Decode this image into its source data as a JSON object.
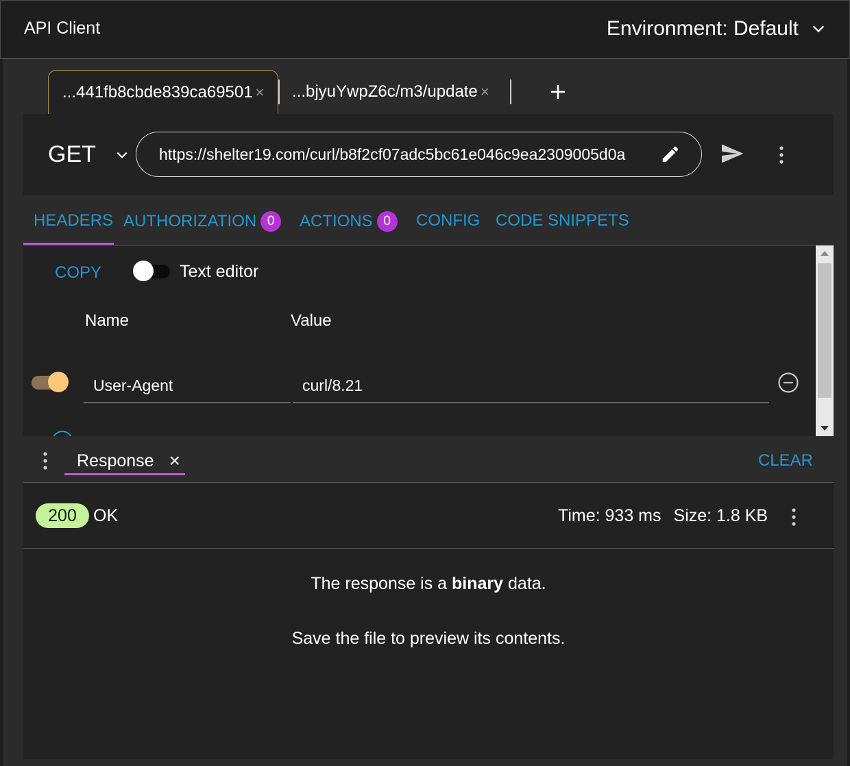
{
  "app": {
    "title": "API Client"
  },
  "environment": {
    "label": "Environment: Default"
  },
  "tabs": [
    {
      "label": "...441fb8cbde839ca69501",
      "active": true
    },
    {
      "label": "...bjyuYwpZ6c/m3/update",
      "active": false
    }
  ],
  "tab_close_glyph": "×",
  "request": {
    "method": "GET",
    "url": "https://shelter19.com/curl/b8f2cf07adc5bc61e046c9ea2309005d0a"
  },
  "request_tabs": [
    {
      "label": "HEADERS",
      "badge": null
    },
    {
      "label": "AUTHORIZATION",
      "badge": "0"
    },
    {
      "label": "ACTIONS",
      "badge": "0"
    },
    {
      "label": "CONFIG",
      "badge": null
    },
    {
      "label": "CODE SNIPPETS",
      "badge": null
    }
  ],
  "headers_panel": {
    "copy_label": "COPY",
    "text_editor_label": "Text editor",
    "text_editor_enabled": false,
    "columns": {
      "name": "Name",
      "value": "Value"
    },
    "rows": [
      {
        "enabled": true,
        "name": "User-Agent",
        "value": "curl/8.21"
      }
    ]
  },
  "response_panel": {
    "tab_label": "Response",
    "close_glyph": "×",
    "clear_label": "CLEAR",
    "status_code": "200",
    "status_text": "OK",
    "time": "Time: 933 ms",
    "size": "Size: 1.8 KB",
    "message_prefix": "The response is a ",
    "message_bold": "binary",
    "message_suffix": " data.",
    "message_line2": "Save the file to preview its contents."
  },
  "colors": {
    "accent_blue": "#2496d0",
    "tab_underline": "#c254e0",
    "badge": "#b534d6",
    "status_ok": "#c6f39a",
    "toggle_on": "#ffc777"
  }
}
